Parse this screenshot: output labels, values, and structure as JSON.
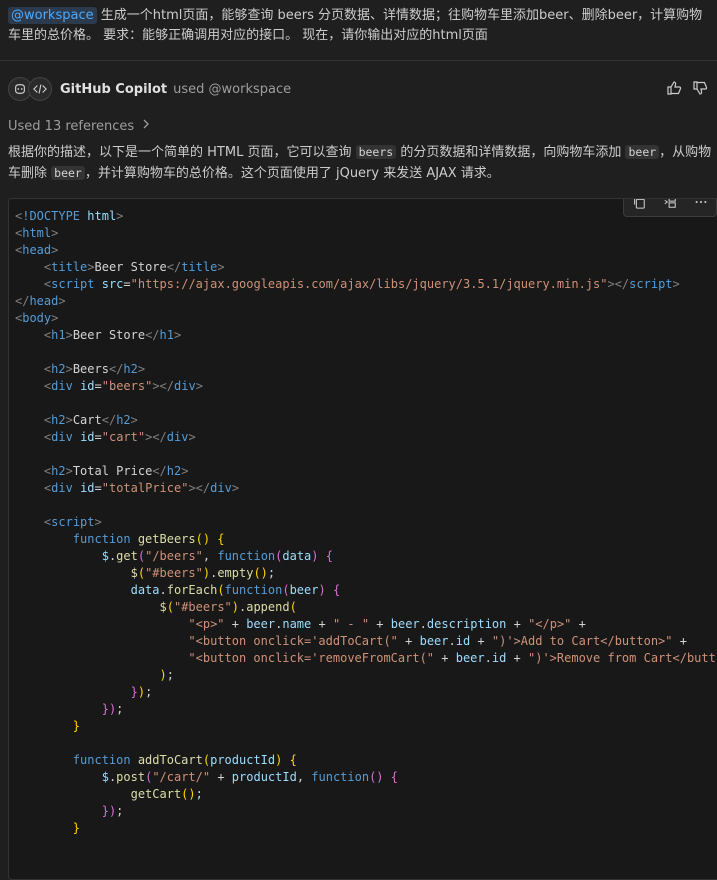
{
  "request": {
    "mention": "@workspace",
    "text": " 生成一个html页面，能够查询 beers 分页数据、详情数据；往购物车里添加beer、删除beer，计算购物车里的总价格。 要求：能够正确调用对应的接口。 现在，请你输出对应的html页面"
  },
  "response": {
    "agent_name": "GitHub Copilot",
    "used_label": "used @workspace",
    "references_label": "Used 13 references",
    "intro": {
      "p1": "根据你的描述，以下是一个简单的 HTML 页面，它可以查询 ",
      "c1": "beers",
      "p2": " 的分页数据和详情数据，向购物车添加 ",
      "c2": "beer",
      "p3": "，从购物车删除 ",
      "c3": "beer",
      "p4": "，并计算购物车的总价格。这个页面使用了 jQuery 来发送 AJAX 请求。"
    }
  },
  "icons": {
    "avatar1": "copilot-icon",
    "avatar2": "code-icon",
    "thumbs_up": "thumbs-up-icon",
    "thumbs_down": "thumbs-down-icon",
    "chevron": "chevron-right-icon",
    "copy": "copy-icon",
    "insert": "insert-icon",
    "more": "more-icon"
  },
  "code": {
    "doctype": "!DOCTYPE",
    "html_kw": "html",
    "title_text": "Beer Store",
    "script_src": "\"https://ajax.googleapis.com/ajax/libs/jquery/3.5.1/jquery.min.js\"",
    "h1_text": "Beer Store",
    "h2_beers": "Beers",
    "id_beers": "\"beers\"",
    "h2_cart": "Cart",
    "id_cart": "\"cart\"",
    "h2_total": "Total Price",
    "id_total": "\"totalPrice\"",
    "fn_getBeers": "getBeers",
    "url_beers": "\"/beers\"",
    "sel_beers": "\"#beers\"",
    "str_p_open": "\"<p>\"",
    "str_dash": "\" - \"",
    "str_p_close": "\"</p>\"",
    "str_btn_add_open": "\"<button onclick='addToCart(\"",
    "str_btn_add_close": "\")'>Add to Cart</button>\"",
    "str_btn_rm_open": "\"<button onclick='removeFromCart(\"",
    "str_btn_rm_close": "\")'>Remove from Cart</butt",
    "fn_addToCart": "addToCart",
    "url_cart": "\"/cart/\""
  }
}
